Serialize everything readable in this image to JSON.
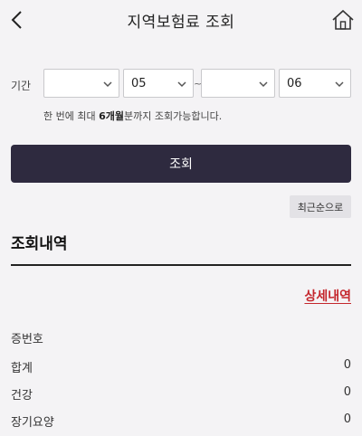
{
  "header": {
    "title": "지역보험료 조회",
    "back_icon": "chevron-left-icon",
    "home_icon": "home-icon"
  },
  "filter": {
    "period_label": "기간",
    "start_year": "",
    "start_month": "05",
    "range_separator": "~",
    "end_year": "",
    "end_month": "06",
    "notice_prefix": "한 번에 최대 ",
    "notice_bold": "6개월",
    "notice_suffix": "분까지 조회가능합니다."
  },
  "actions": {
    "query_label": "조회",
    "sort_label": "최근순으로"
  },
  "results": {
    "title": "조회내역",
    "detail_link": "상세내역",
    "rows": [
      {
        "label": "증번호",
        "value": ""
      },
      {
        "label": "합계",
        "value": "0"
      },
      {
        "label": "건강",
        "value": "0"
      },
      {
        "label": "장기요양",
        "value": "0"
      }
    ]
  },
  "colors": {
    "primary_button": "#2e2a3f",
    "link_red": "#c4262c",
    "background": "#f4f3f5"
  }
}
